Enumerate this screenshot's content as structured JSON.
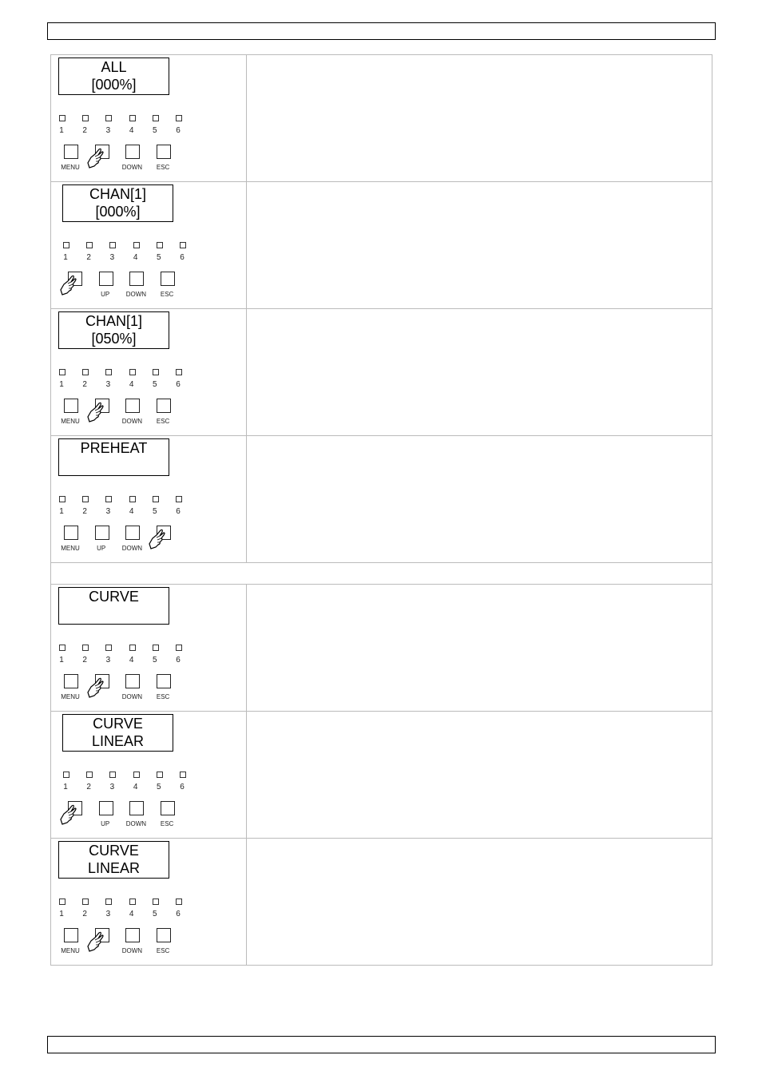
{
  "header": {
    "text": ""
  },
  "footer": {
    "text": ""
  },
  "rows": [
    {
      "display": [
        "ALL",
        "[000%]"
      ],
      "leds": [
        "1",
        "2",
        "3",
        "4",
        "5",
        "6"
      ],
      "buttons": [
        "MENU",
        "",
        "DOWN",
        "ESC"
      ],
      "pressed": 1,
      "shift": 0,
      "description": ""
    },
    {
      "display": [
        "CHAN[1]",
        "[000%]"
      ],
      "leds": [
        "1",
        "2",
        "3",
        "4",
        "5",
        "6"
      ],
      "buttons": [
        "",
        "UP",
        "DOWN",
        "ESC"
      ],
      "pressed": 0,
      "shift": 1,
      "description": ""
    },
    {
      "display": [
        "CHAN[1]",
        "[050%]"
      ],
      "leds": [
        "1",
        "2",
        "3",
        "4",
        "5",
        "6"
      ],
      "buttons": [
        "MENU",
        "",
        "DOWN",
        "ESC"
      ],
      "pressed": 1,
      "shift": 0,
      "description": ""
    },
    {
      "display": [
        "PREHEAT",
        ""
      ],
      "leds": [
        "1",
        "2",
        "3",
        "4",
        "5",
        "6"
      ],
      "buttons": [
        "MENU",
        "UP",
        "DOWN",
        ""
      ],
      "pressed": 3,
      "shift": 0,
      "description": ""
    },
    {
      "spacer": true,
      "text": ""
    },
    {
      "display": [
        "CURVE",
        ""
      ],
      "leds": [
        "1",
        "2",
        "3",
        "4",
        "5",
        "6"
      ],
      "buttons": [
        "MENU",
        "",
        "DOWN",
        "ESC"
      ],
      "pressed": 1,
      "shift": 0,
      "description": ""
    },
    {
      "display": [
        "CURVE",
        "LINEAR"
      ],
      "leds": [
        "1",
        "2",
        "3",
        "4",
        "5",
        "6"
      ],
      "buttons": [
        "",
        "UP",
        "DOWN",
        "ESC"
      ],
      "pressed": 0,
      "shift": 1,
      "description": ""
    },
    {
      "display": [
        "CURVE",
        "LINEAR"
      ],
      "leds": [
        "1",
        "2",
        "3",
        "4",
        "5",
        "6"
      ],
      "buttons": [
        "MENU",
        "",
        "DOWN",
        "ESC"
      ],
      "pressed": 1,
      "shift": 0,
      "description": ""
    }
  ]
}
